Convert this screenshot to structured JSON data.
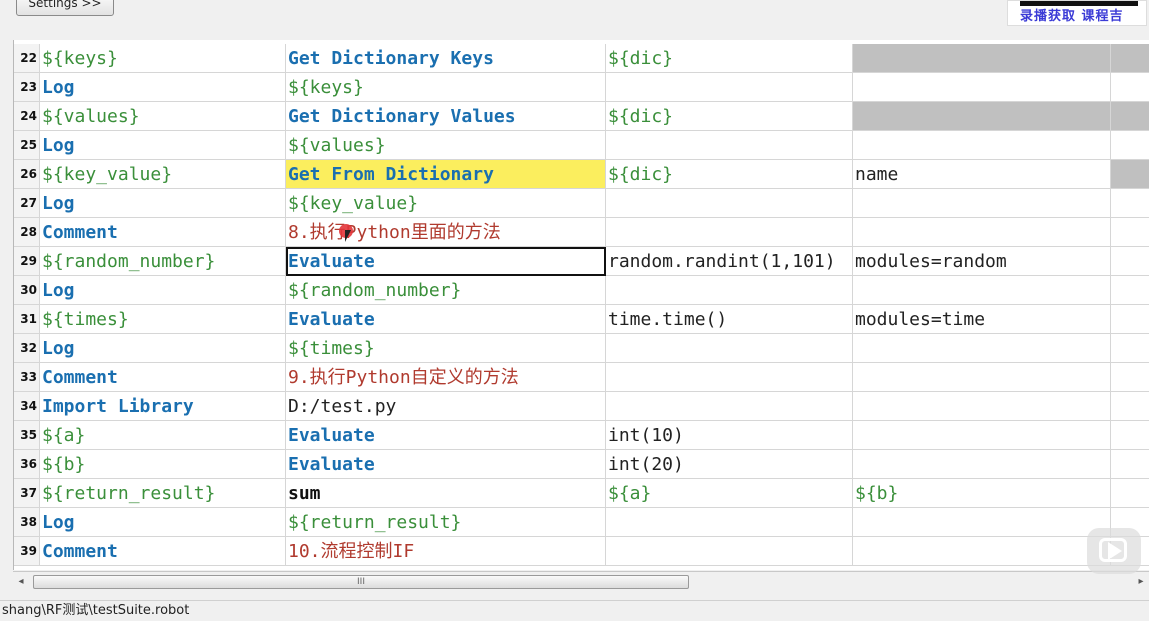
{
  "toolbar": {
    "settings_label": "Settings >>"
  },
  "brand": {
    "text": "录播获取 课程吉"
  },
  "rows": [
    {
      "num": "22",
      "c1": "${keys}",
      "c1t": "var",
      "c2": "Get Dictionary Keys",
      "c2t": "kw",
      "c3": "${dic}",
      "c3t": "var",
      "c4": "",
      "c4t": "gray",
      "c5": "",
      "c5t": "gray"
    },
    {
      "num": "23",
      "c1": "Log",
      "c1t": "kw",
      "c2": "${keys}",
      "c2t": "var",
      "c3": "",
      "c3t": "plain",
      "c4": "",
      "c4t": "plain",
      "c5": "",
      "c5t": "plain"
    },
    {
      "num": "24",
      "c1": "${values}",
      "c1t": "var",
      "c2": "Get Dictionary Values",
      "c2t": "kw",
      "c3": "${dic}",
      "c3t": "var",
      "c4": "",
      "c4t": "gray",
      "c5": "",
      "c5t": "gray"
    },
    {
      "num": "25",
      "c1": "Log",
      "c1t": "kw",
      "c2": "${values}",
      "c2t": "var",
      "c3": "",
      "c3t": "plain",
      "c4": "",
      "c4t": "plain",
      "c5": "",
      "c5t": "plain"
    },
    {
      "num": "26",
      "c1": "${key_value}",
      "c1t": "var",
      "c2": "Get From Dictionary",
      "c2t": "kw yellow",
      "c3": "${dic}",
      "c3t": "var",
      "c4": "name",
      "c4t": "plain",
      "c5": "",
      "c5t": "gray"
    },
    {
      "num": "27",
      "c1": "Log",
      "c1t": "kw",
      "c2": "${key_value}",
      "c2t": "var",
      "c3": "",
      "c3t": "plain",
      "c4": "",
      "c4t": "plain",
      "c5": "",
      "c5t": "plain"
    },
    {
      "num": "28",
      "c1": "Comment",
      "c1t": "kw",
      "c2": "8.执行Python里面的方法",
      "c2t": "cmt",
      "c3": "",
      "c3t": "plain",
      "c4": "",
      "c4t": "plain",
      "c5": "",
      "c5t": "plain"
    },
    {
      "num": "29",
      "c1": "${random_number}",
      "c1t": "var",
      "c2": "Evaluate",
      "c2t": "kw selected",
      "c3": "random.randint(1,101)",
      "c3t": "plain",
      "c4": "modules=random",
      "c4t": "plain",
      "c5": "",
      "c5t": "plain"
    },
    {
      "num": "30",
      "c1": "Log",
      "c1t": "kw",
      "c2": "${random_number}",
      "c2t": "var",
      "c3": "",
      "c3t": "plain",
      "c4": "",
      "c4t": "plain",
      "c5": "",
      "c5t": "plain"
    },
    {
      "num": "31",
      "c1": "${times}",
      "c1t": "var",
      "c2": "Evaluate",
      "c2t": "kw",
      "c3": "time.time()",
      "c3t": "plain",
      "c4": "modules=time",
      "c4t": "plain",
      "c5": "",
      "c5t": "plain"
    },
    {
      "num": "32",
      "c1": "Log",
      "c1t": "kw",
      "c2": "${times}",
      "c2t": "var",
      "c3": "",
      "c3t": "plain",
      "c4": "",
      "c4t": "plain",
      "c5": "",
      "c5t": "plain"
    },
    {
      "num": "33",
      "c1": "Comment",
      "c1t": "kw",
      "c2": "9.执行Python自定义的方法",
      "c2t": "cmt",
      "c3": "",
      "c3t": "plain",
      "c4": "",
      "c4t": "plain",
      "c5": "",
      "c5t": "plain"
    },
    {
      "num": "34",
      "c1": "Import Library",
      "c1t": "kw",
      "c2": "D:/test.py",
      "c2t": "plain",
      "c3": "",
      "c3t": "plain",
      "c4": "",
      "c4t": "plain",
      "c5": "",
      "c5t": "plain"
    },
    {
      "num": "35",
      "c1": "${a}",
      "c1t": "var",
      "c2": "Evaluate",
      "c2t": "kw",
      "c3": "int(10)",
      "c3t": "plain",
      "c4": "",
      "c4t": "plain",
      "c5": "",
      "c5t": "plain"
    },
    {
      "num": "36",
      "c1": "${b}",
      "c1t": "var",
      "c2": "Evaluate",
      "c2t": "kw",
      "c3": "int(20)",
      "c3t": "plain",
      "c4": "",
      "c4t": "plain",
      "c5": "",
      "c5t": "plain"
    },
    {
      "num": "37",
      "c1": "${return_result}",
      "c1t": "var",
      "c2": "sum",
      "c2t": "kwblack",
      "c3": "${a}",
      "c3t": "var",
      "c4": "${b}",
      "c4t": "var",
      "c5": "",
      "c5t": "plain"
    },
    {
      "num": "38",
      "c1": "Log",
      "c1t": "kw",
      "c2": "${return_result}",
      "c2t": "var",
      "c3": "",
      "c3t": "plain",
      "c4": "",
      "c4t": "plain",
      "c5": "",
      "c5t": "plain"
    },
    {
      "num": "39",
      "c1": "Comment",
      "c1t": "kw",
      "c2": "10.流程控制IF",
      "c2t": "cmt",
      "c3": "",
      "c3t": "plain",
      "c4": "",
      "c4t": "plain",
      "c5": "",
      "c5t": "plain"
    }
  ],
  "scrollbar": {
    "grip": "III",
    "left_arrow": "◂",
    "right_arrow": "▸"
  },
  "status": {
    "path": "shang\\RF测试\\testSuite.robot"
  }
}
